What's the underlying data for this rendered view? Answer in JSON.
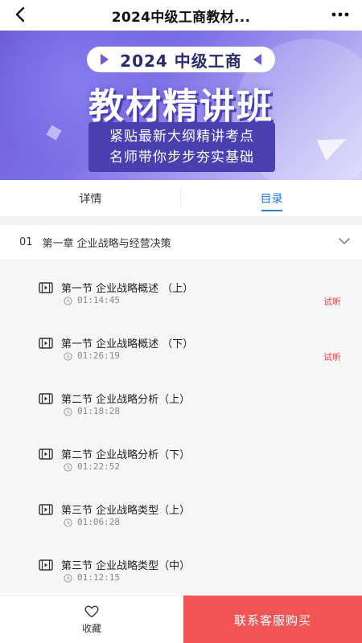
{
  "nav": {
    "title": "2024中级工商教材...",
    "back_icon": "chevron-left-icon",
    "more_icon": "more-horizontal-icon"
  },
  "banner": {
    "pill_text": "2024 中级工商",
    "headline": "教材精讲班",
    "sub_line1": "紧贴最新大纲精讲考点",
    "sub_line2": "名师带你步步夯实基础"
  },
  "tabs": [
    {
      "label": "详情",
      "active": false
    },
    {
      "label": "目录",
      "active": true
    }
  ],
  "chapter": {
    "number": "01",
    "title": "第一章  企业战略与经营决策",
    "expand_icon": "chevron-down-icon"
  },
  "lessons": [
    {
      "title": "第一节  企业战略概述 （上）",
      "duration": "01:14:45",
      "trial": "试听"
    },
    {
      "title": "第一节  企业战略概述 （下）",
      "duration": "01:26:19",
      "trial": "试听"
    },
    {
      "title": "第二节  企业战略分析（上）",
      "duration": "01:18:28",
      "trial": ""
    },
    {
      "title": "第二节  企业战略分析（下）",
      "duration": "01:22:52",
      "trial": ""
    },
    {
      "title": "第三节  企业战略类型（上）",
      "duration": "01:06:28",
      "trial": ""
    },
    {
      "title": "第三节  企业战略类型（中）",
      "duration": "01:12:15",
      "trial": ""
    }
  ],
  "bottom": {
    "favorite_label": "收藏",
    "favorite_icon": "heart-icon",
    "buy_label": "联系客服购买"
  },
  "colors": {
    "accent_blue": "#2d7bd9",
    "trial_red": "#e24a4a",
    "buy_red": "#f25553",
    "banner_purple": "#6a5bd6"
  }
}
